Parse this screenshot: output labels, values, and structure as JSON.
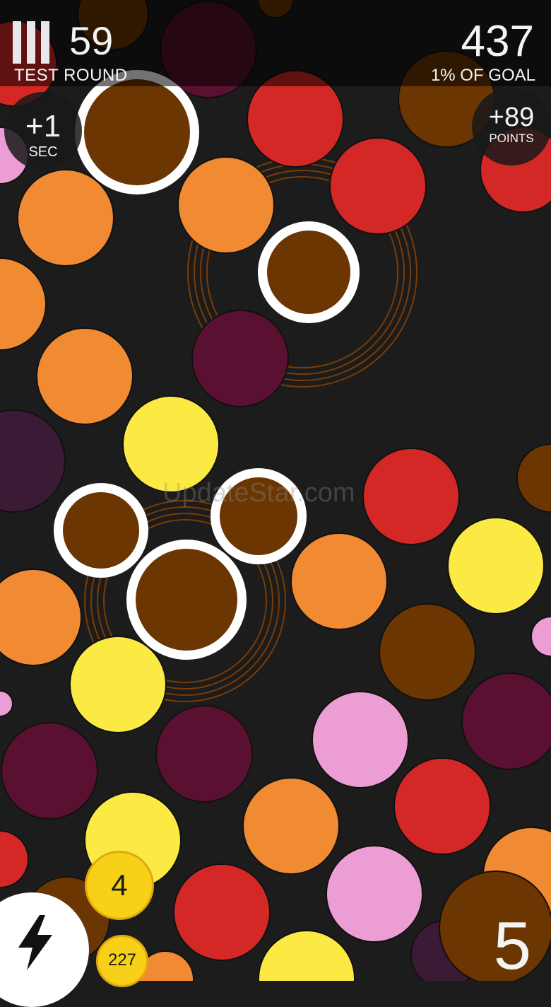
{
  "palette": {
    "background": "#1c1c1c",
    "red": "#d42826",
    "orange": "#f08a33",
    "yellow": "#fbe944",
    "pink": "#ec9ed4",
    "brown": "#6b3602",
    "maroon": "#5a1030",
    "plum": "#3a1a34",
    "ring": "#ffffff",
    "badge": "#f7d117"
  },
  "header": {
    "menu_icon": "pause-bars-icon",
    "time_value": "59",
    "round_label": "TEST ROUND",
    "score_value": "437",
    "goal_label": "1% OF GOAL"
  },
  "bonuses": {
    "seconds": {
      "value": "+1",
      "label": "SEC"
    },
    "points": {
      "value": "+89",
      "label": "POINTS"
    }
  },
  "footer": {
    "power_icon": "lightning-bolt-icon",
    "badge_primary": "4",
    "badge_secondary": "227",
    "moves_value": "5"
  },
  "watermark": "UpdateStar.com"
}
